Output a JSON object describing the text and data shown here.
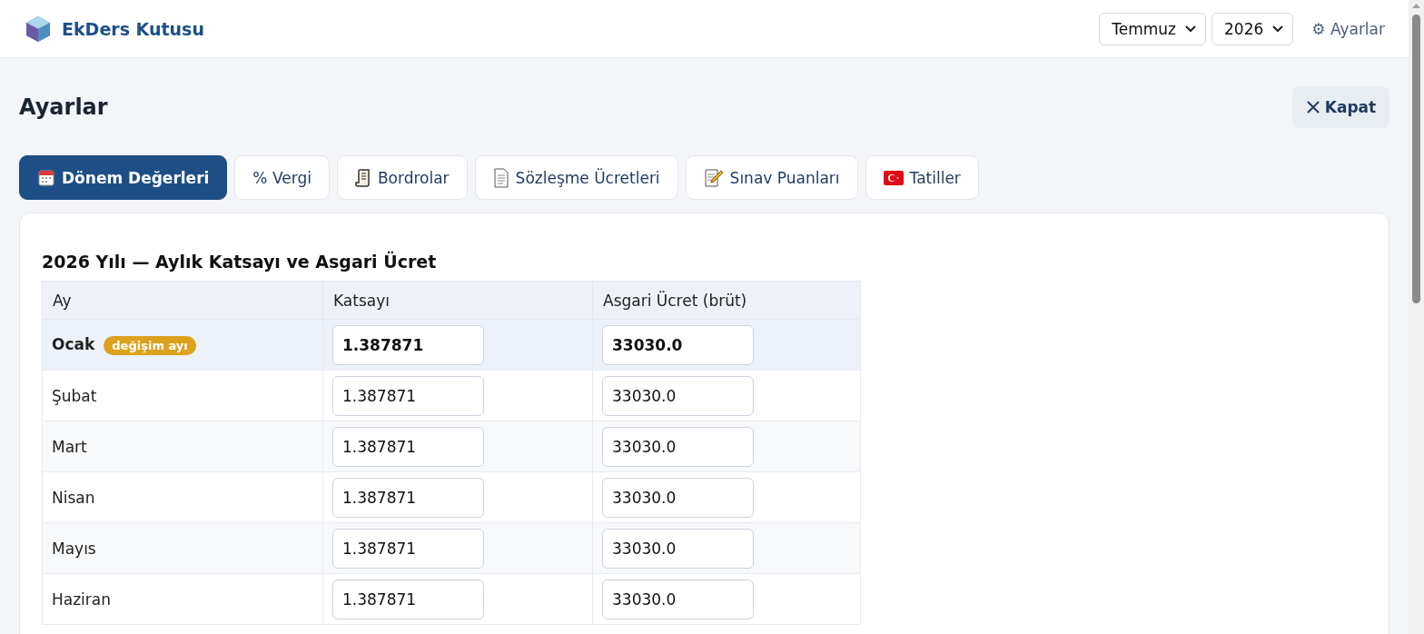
{
  "app": {
    "title": "EkDers Kutusu"
  },
  "header": {
    "month": "Temmuz",
    "year": "2026",
    "settings_link": "⚙ Ayarlar"
  },
  "page": {
    "title": "Ayarlar",
    "close_button": "Kapat"
  },
  "tabs": [
    {
      "label": "Dönem Değerleri",
      "selected": true
    },
    {
      "label": "% Vergi",
      "selected": false
    },
    {
      "label": "Bordrolar",
      "selected": false
    },
    {
      "label": "Sözleşme Ücretleri",
      "selected": false
    },
    {
      "label": "Sınav Puanları",
      "selected": false
    },
    {
      "label": "Tatiller",
      "selected": false
    }
  ],
  "section": {
    "title": "2026 Yılı — Aylık Katsayı ve Asgari Ücret"
  },
  "table": {
    "columns": [
      "Ay",
      "Katsayı",
      "Asgari Ücret (brüt)"
    ],
    "rows": [
      {
        "month": "Ocak",
        "badge": "değişim ayı",
        "highlighted": true,
        "coefficient": "1.387871",
        "min_wage": "33030.0"
      },
      {
        "month": "Şubat",
        "highlighted": false,
        "coefficient": "1.387871",
        "min_wage": "33030.0"
      },
      {
        "month": "Mart",
        "highlighted": false,
        "coefficient": "1.387871",
        "min_wage": "33030.0"
      },
      {
        "month": "Nisan",
        "highlighted": false,
        "coefficient": "1.387871",
        "min_wage": "33030.0"
      },
      {
        "month": "Mayıs",
        "highlighted": false,
        "coefficient": "1.387871",
        "min_wage": "33030.0"
      },
      {
        "month": "Haziran",
        "highlighted": false,
        "coefficient": "1.387871",
        "min_wage": "33030.0"
      }
    ]
  }
}
